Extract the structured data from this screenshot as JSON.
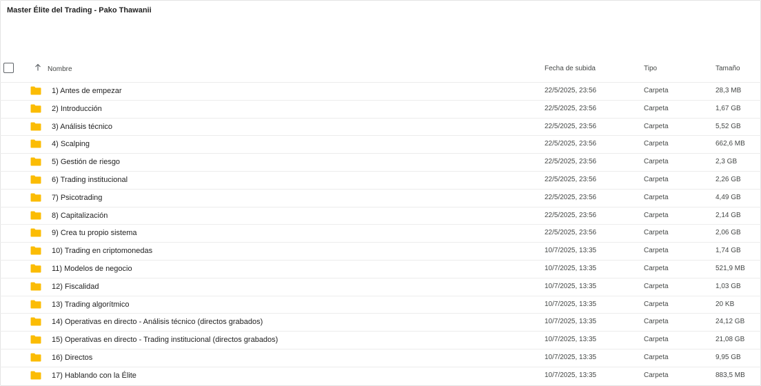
{
  "title": "Master Élite del Trading - Pako Thawanii",
  "header": {
    "name": "Nombre",
    "date": "Fecha de subida",
    "type": "Tipo",
    "size": "Tamaño",
    "sort_icon": "arrow-up-icon",
    "select_all_icon": "checkbox-icon"
  },
  "folder_color": "#fbbc04",
  "rows": [
    {
      "name": "1) Antes de empezar",
      "date": "22/5/2025, 23:56",
      "type": "Carpeta",
      "size": "28,3 MB"
    },
    {
      "name": "2) Introducción",
      "date": "22/5/2025, 23:56",
      "type": "Carpeta",
      "size": "1,67 GB"
    },
    {
      "name": "3) Análisis técnico",
      "date": "22/5/2025, 23:56",
      "type": "Carpeta",
      "size": "5,52 GB"
    },
    {
      "name": "4) Scalping",
      "date": "22/5/2025, 23:56",
      "type": "Carpeta",
      "size": "662,6 MB"
    },
    {
      "name": "5) Gestión de riesgo",
      "date": "22/5/2025, 23:56",
      "type": "Carpeta",
      "size": "2,3 GB"
    },
    {
      "name": "6) Trading institucional",
      "date": "22/5/2025, 23:56",
      "type": "Carpeta",
      "size": "2,26 GB"
    },
    {
      "name": "7) Psicotrading",
      "date": "22/5/2025, 23:56",
      "type": "Carpeta",
      "size": "4,49 GB"
    },
    {
      "name": "8) Capitalización",
      "date": "22/5/2025, 23:56",
      "type": "Carpeta",
      "size": "2,14 GB"
    },
    {
      "name": "9) Crea tu propio sistema",
      "date": "22/5/2025, 23:56",
      "type": "Carpeta",
      "size": "2,06 GB"
    },
    {
      "name": "10) Trading en criptomonedas",
      "date": "10/7/2025, 13:35",
      "type": "Carpeta",
      "size": "1,74 GB"
    },
    {
      "name": "11) Modelos de negocio",
      "date": "10/7/2025, 13:35",
      "type": "Carpeta",
      "size": "521,9 MB"
    },
    {
      "name": "12) Fiscalidad",
      "date": "10/7/2025, 13:35",
      "type": "Carpeta",
      "size": "1,03 GB"
    },
    {
      "name": "13) Trading algorítmico",
      "date": "10/7/2025, 13:35",
      "type": "Carpeta",
      "size": "20 KB"
    },
    {
      "name": "14) Operativas en directo - Análisis técnico (directos grabados)",
      "date": "10/7/2025, 13:35",
      "type": "Carpeta",
      "size": "24,12 GB"
    },
    {
      "name": "15) Operativas en directo - Trading institucional (directos grabados)",
      "date": "10/7/2025, 13:35",
      "type": "Carpeta",
      "size": "21,08 GB"
    },
    {
      "name": "16) Directos",
      "date": "10/7/2025, 13:35",
      "type": "Carpeta",
      "size": "9,95 GB"
    },
    {
      "name": "17) Hablando con la Élite",
      "date": "10/7/2025, 13:35",
      "type": "Carpeta",
      "size": "883,5 MB"
    }
  ]
}
